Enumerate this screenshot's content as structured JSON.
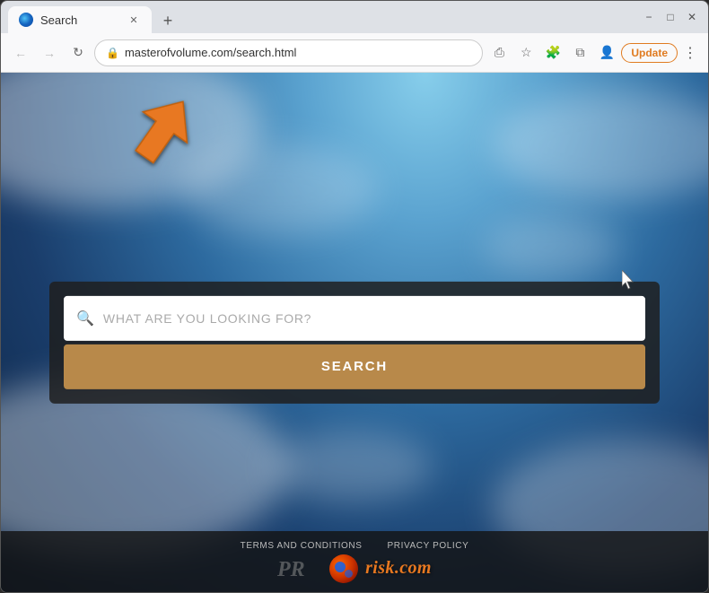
{
  "browser": {
    "tab": {
      "title": "Search",
      "favicon_alt": "browser-favicon"
    },
    "address_bar": {
      "url": "masterofvolume.com/search.html",
      "lock_icon": "🔒"
    },
    "buttons": {
      "back": "←",
      "forward": "→",
      "refresh": "↻",
      "new_tab": "+",
      "minimize": "−",
      "maximize": "□",
      "close": "✕",
      "update_label": "Update",
      "menu_dots": "⋮",
      "share": "⎙",
      "bookmark": "☆",
      "extensions": "🧩",
      "split": "⧉",
      "profile": "👤"
    }
  },
  "page": {
    "search_widget": {
      "input_placeholder": "WHAT ARE YOU LOOKING FOR?",
      "search_button_label": "SEARCH"
    },
    "footer": {
      "links": [
        {
          "label": "TERMS AND CONDITIONS"
        },
        {
          "label": "PRIVACY POLICY"
        }
      ],
      "brand_text": "risk.com"
    }
  },
  "arrow_annotation": {
    "color": "#e87820",
    "direction": "up-right"
  }
}
